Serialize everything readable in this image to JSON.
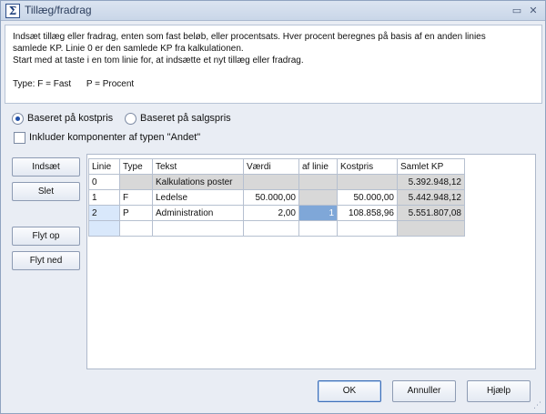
{
  "window": {
    "title": "Tillæg/fradrag",
    "icon": "sigma-icon",
    "minimize_glyph": "▭",
    "close_glyph": "✕"
  },
  "info": {
    "line1": "Indsæt tillæg eller fradrag, enten som fast beløb, eller procentsats. Hver procent beregnes på basis af en anden linies",
    "line2": "samlede KP. Linie 0 er den samlede KP fra kalkulationen.",
    "line3": "Start med at taste i en tom linie for, at indsætte et nyt tillæg eller fradrag.",
    "line4": "Type: F = Fast      P = Procent"
  },
  "options": {
    "radio_cost": "Baseret på kostpris",
    "radio_sales": "Baseret på salgspris",
    "checkbox_other": "Inkluder komponenter af typen \"Andet\""
  },
  "side_buttons": {
    "insert": "Indsæt",
    "delete": "Slet",
    "move_up": "Flyt op",
    "move_down": "Flyt ned"
  },
  "grid": {
    "columns": [
      "Linie",
      "Type",
      "Tekst",
      "Værdi",
      "af linie",
      "Kostpris",
      "Samlet KP"
    ],
    "rows": [
      {
        "linie": "0",
        "type": "",
        "tekst": "Kalkulations poster",
        "vaerdi": "",
        "af_linie": "",
        "kostpris": "",
        "samlet_kp": "5.392.948,12"
      },
      {
        "linie": "1",
        "type": "F",
        "tekst": "Ledelse",
        "vaerdi": "50.000,00",
        "af_linie": "",
        "kostpris": "50.000,00",
        "samlet_kp": "5.442.948,12"
      },
      {
        "linie": "2",
        "type": "P",
        "tekst": "Administration",
        "vaerdi": "2,00",
        "af_linie": "1",
        "kostpris": "108.858,96",
        "samlet_kp": "5.551.807,08"
      }
    ]
  },
  "bottom_buttons": {
    "ok": "OK",
    "cancel": "Annuller",
    "help": "Hjælp"
  },
  "colors": {
    "accent": "#1f4fa8",
    "highlight_cell": "#7fa7d8",
    "selected_row": "#d9e8fb",
    "readonly_cell": "#d8d8d8"
  }
}
